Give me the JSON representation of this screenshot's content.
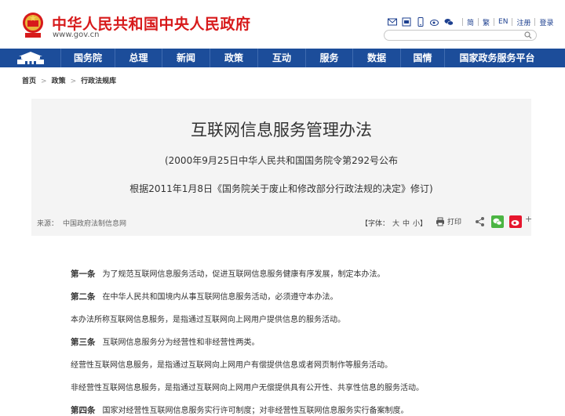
{
  "header": {
    "site_title": "中华人民共和国中央人民政府",
    "site_url": "www.gov.cn",
    "links": [
      "繁",
      "EN",
      "注册",
      "登录"
    ],
    "simplified_label": "简"
  },
  "nav": {
    "items": [
      "国务院",
      "总理",
      "新闻",
      "政策",
      "互动",
      "服务",
      "数据",
      "国情",
      "国家政务服务平台"
    ]
  },
  "breadcrumb": [
    "首页",
    "政策",
    "行政法规库"
  ],
  "article": {
    "title": "互联网信息服务管理办法",
    "subtitle1": "(2000年9月25日中华人民共和国国务院令第292号公布",
    "subtitle2": "根据2011年1月8日《国务院关于废止和修改部分行政法规的决定》修订)",
    "source_label": "来源：",
    "source_value": "中国政府法制信息网",
    "font_label": "【字体：",
    "font_big": "大",
    "font_mid": "中",
    "font_small": "小】",
    "print_label": "打印",
    "plus_label": "+"
  },
  "paragraphs": [
    {
      "label": "第一条",
      "text": "为了规范互联网信息服务活动，促进互联网信息服务健康有序发展，制定本办法。"
    },
    {
      "label": "第二条",
      "text": "在中华人民共和国境内从事互联网信息服务活动，必须遵守本办法。"
    },
    {
      "label": "",
      "text": "本办法所称互联网信息服务，是指通过互联网向上网用户提供信息的服务活动。"
    },
    {
      "label": "第三条",
      "text": "互联网信息服务分为经营性和非经营性两类。"
    },
    {
      "label": "",
      "text": "经营性互联网信息服务，是指通过互联网向上网用户有偿提供信息或者网页制作等服务活动。"
    },
    {
      "label": "",
      "text": "非经营性互联网信息服务，是指通过互联网向上网用户无偿提供具有公开性、共享性信息的服务活动。"
    },
    {
      "label": "第四条",
      "text": "国家对经营性互联网信息服务实行许可制度；对非经营性互联网信息服务实行备案制度。"
    }
  ],
  "colors": {
    "brand_red": "#d71a1b",
    "nav_blue": "#1c4d9a",
    "link_blue": "#1c3f8f"
  }
}
